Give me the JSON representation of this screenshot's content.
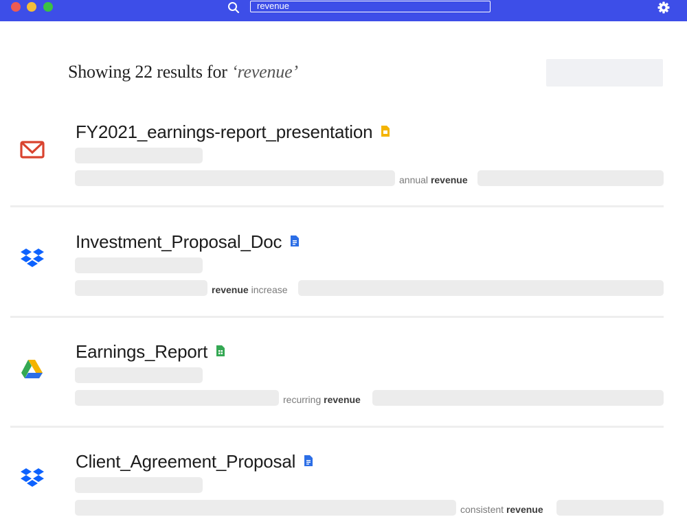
{
  "search": {
    "query": "revenue"
  },
  "heading": {
    "prefix": "Showing 22 results for ",
    "query": "‘revenue’"
  },
  "results": [
    {
      "source": "gmail-icon",
      "title": "FY2021_earnings-report_presentation",
      "file_type": "slides-icon",
      "snippet_pre": "annual",
      "snippet_em": "revenue",
      "snippet_post": ""
    },
    {
      "source": "dropbox-icon",
      "title": "Investment_Proposal_Doc",
      "file_type": "docs-icon",
      "snippet_pre": "",
      "snippet_em": "revenue",
      "snippet_post": "increase"
    },
    {
      "source": "google-drive-icon",
      "title": "Earnings_Report",
      "file_type": "sheets-icon",
      "snippet_pre": "recurring",
      "snippet_em": "revenue",
      "snippet_post": ""
    },
    {
      "source": "dropbox-icon",
      "title": "Client_Agreement_Proposal",
      "file_type": "docs-icon",
      "snippet_pre": "consistent",
      "snippet_em": "revenue",
      "snippet_post": ""
    }
  ],
  "colors": {
    "titlebar": "#3d4ee8",
    "slides": "#f4b400",
    "docs": "#2c6ee6",
    "sheets": "#34a853",
    "dropbox": "#0d62fe",
    "gmail": "#d9432f"
  }
}
